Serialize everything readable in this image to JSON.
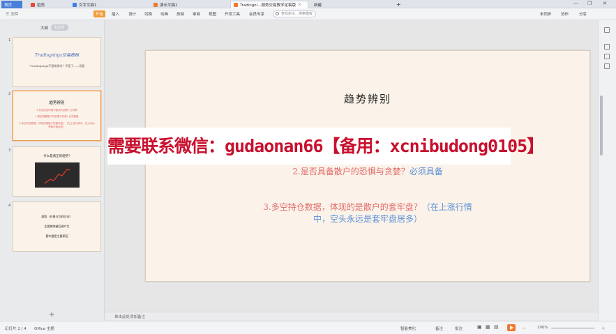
{
  "tabs": [
    {
      "label": "首页"
    },
    {
      "label": "稻壳"
    },
    {
      "label": "文字文稿1"
    },
    {
      "label": "演示文稿1"
    },
    {
      "label": "Tradingni...顺势交易教学定稿版"
    },
    {
      "label": "新建"
    }
  ],
  "menu": {
    "file": "三 文件",
    "items": [
      "开始",
      "插入",
      "设计",
      "切换",
      "动画",
      "放映",
      "审阅",
      "视图",
      "开发工具",
      "会员专享"
    ],
    "search_placeholder": "查找命令、搜索模板",
    "right": [
      "未同步",
      "协作",
      "分享"
    ]
  },
  "panel": {
    "tab_outline": "大纲",
    "tab_slides": "幻灯片"
  },
  "thumbnails": [
    {
      "num": "1",
      "title": "Tradingninja交易搭档",
      "subtitle": "\"Tradingninja不是做多吗？不是了——但是"
    },
    {
      "num": "2",
      "title": "趋势辨别",
      "l1": "1.在涨后的时候不能追大趋势? 必须具",
      "l2": "2.是否具备散户的恐惧与贪婪? 必须具备",
      "l3": "3.多空持仓数据，体现的是散户的套牢盘？（在上涨行情中，空头永远是套牢盘居多）"
    },
    {
      "num": "3",
      "title": "什么是真正的趋势?"
    },
    {
      "num": "4",
      "l1": "顺势（价格与均线方向）",
      "l2": "主要做突破回调产生",
      "l3": "套牢盘是主要原因"
    }
  ],
  "slide": {
    "title": "趋势辨别",
    "line2a": "2.是否具备散户的恐惧与贪婪？",
    "line2b": "必须具备",
    "line3a": "3.多空持仓数据，体现的是散户的套牢盘？",
    "line3b": "（在上涨行情",
    "line3c": "中，空头永远是套牢盘居多）"
  },
  "banner": "需要联系微信：gudaonan66【备用：xcnibudong0105】",
  "notes_placeholder": "单击此处添加备注",
  "status": {
    "slide_count": "幻灯片 2 / 4",
    "theme": "Office 主题",
    "smart_beautify": "智能美化",
    "notes_toggle": "备注",
    "comments": "批注",
    "zoom": "100%"
  },
  "colors": {
    "accent_orange": "#f0782f",
    "banner_red": "#c8102e",
    "text_blue": "#5b8fd9",
    "text_red": "#e06a6a",
    "slide_bg": "#fbf3e9"
  }
}
